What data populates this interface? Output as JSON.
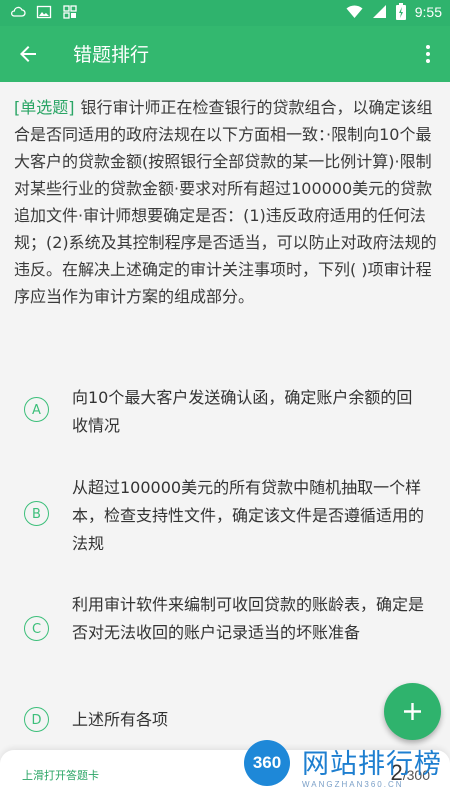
{
  "status_bar": {
    "time": "9:55"
  },
  "app_bar": {
    "title": "错题排行"
  },
  "question": {
    "type_label": "[单选题]",
    "text": "银行审计师正在检查银行的贷款组合，以确定该组合是否同适用的政府法规在以下方面相一致：·限制向10个最大客户的贷款金额(按照银行全部贷款的某一比例计算)·限制对某些行业的贷款金额·要求对所有超过100000美元的贷款追加文件·审计师想要确定是否：(1)违反政府适用的任何法规；(2)系统及其控制程序是否适当，可以防止对政府法规的违反。在解决上述确定的审计关注事项时，下列(   )项审计程序应当作为审计方案的组成部分。"
  },
  "options": [
    {
      "letter": "A",
      "text": "向10个最大客户发送确认函，确定账户余额的回收情况"
    },
    {
      "letter": "B",
      "text": "从超过100000美元的所有贷款中随机抽取一个样本，检查支持性文件，确定该文件是否遵循适用的法规"
    },
    {
      "letter": "C",
      "text": "利用审计软件来编制可收回贷款的账龄表，确定是否对无法收回的账户记录适当的坏账准备"
    },
    {
      "letter": "D",
      "text": "上述所有各项"
    }
  ],
  "bottom_bar": {
    "swipe_hint": "上滑打开答题卡",
    "current": "2",
    "total": "/300"
  },
  "watermark": {
    "logo": "360",
    "text": "网站排行榜",
    "sub": "WANGZHAN360.CN"
  },
  "colors": {
    "primary": "#33b86f",
    "accent": "#2fb36d"
  }
}
